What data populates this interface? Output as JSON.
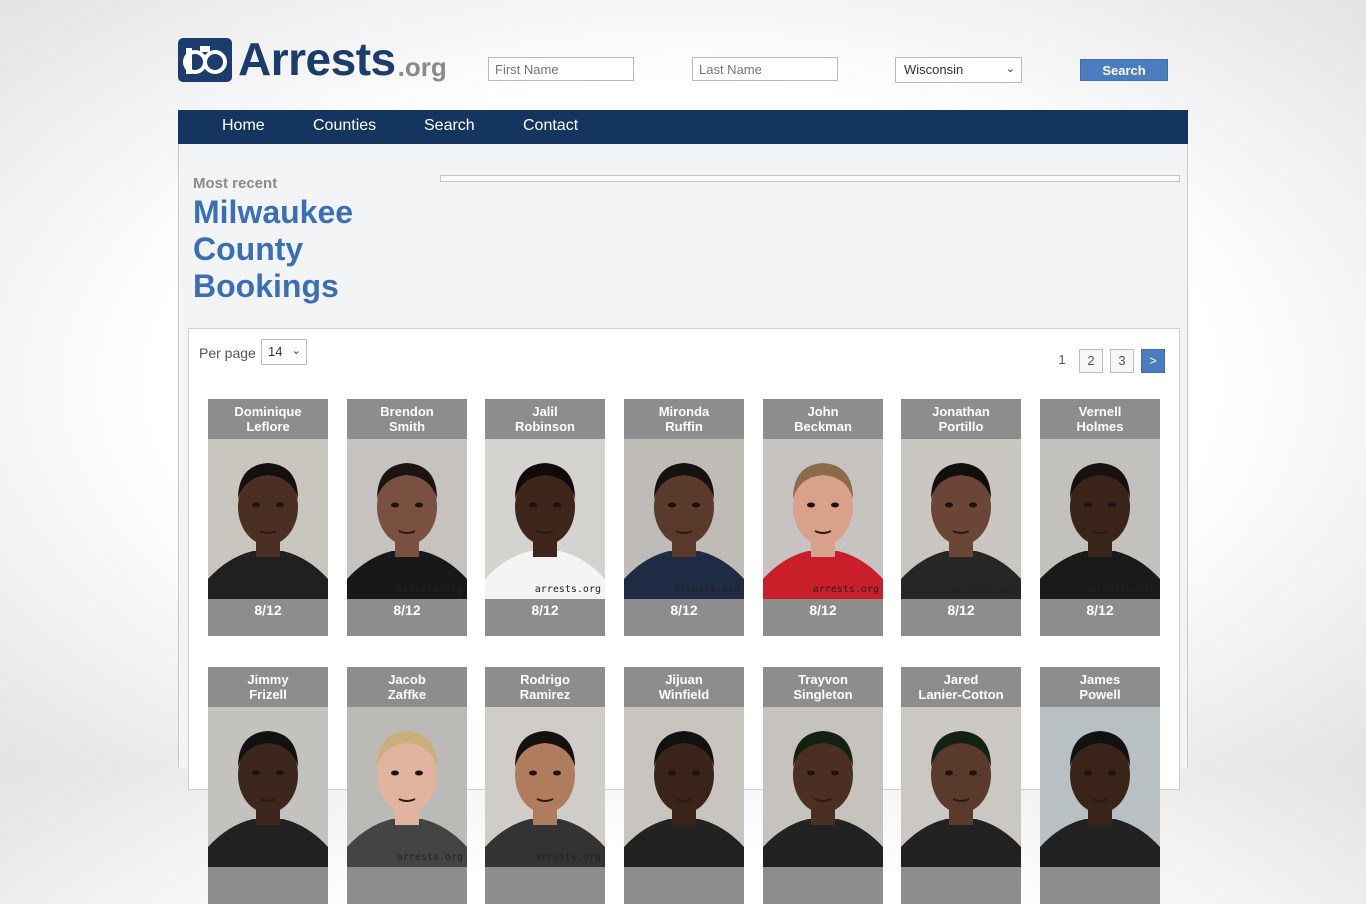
{
  "site": {
    "logo_text": "Arrests",
    "logo_suffix": ".org"
  },
  "search": {
    "first_placeholder": "First Name",
    "last_placeholder": "Last Name",
    "state_selected": "Wisconsin",
    "button_label": "Search"
  },
  "nav": {
    "items": [
      "Home",
      "Counties",
      "Search",
      "Contact"
    ]
  },
  "heading": {
    "kicker": "Most recent",
    "title_line1": "Milwaukee",
    "title_line2": "County",
    "title_line3": "Bookings"
  },
  "listing": {
    "per_page_label": "Per page",
    "per_page_value": "14",
    "pagination": {
      "current": "1",
      "pages": [
        "2",
        "3"
      ],
      "next": ">"
    }
  },
  "watermark": "arrests.org",
  "bookings": [
    {
      "first": "Dominique",
      "last": "Leflore",
      "date": "8/12",
      "bg": "#c9c6c0",
      "skin": "#4a2f22",
      "hair": "#141010",
      "shirt": "#202020"
    },
    {
      "first": "Brendon",
      "last": "Smith",
      "date": "8/12",
      "bg": "#c5c2bf",
      "skin": "#7a5141",
      "hair": "#1a1412",
      "shirt": "#181818"
    },
    {
      "first": "Jalil",
      "last": "Robinson",
      "date": "8/12",
      "bg": "#d5d3d0",
      "skin": "#3e261b",
      "hair": "#0e0b0a",
      "shirt": "#f4f4f4"
    },
    {
      "first": "Mironda",
      "last": "Ruffin",
      "date": "8/12",
      "bg": "#bfbcb7",
      "skin": "#5a3a2a",
      "hair": "#151110",
      "shirt": "#1f2a44"
    },
    {
      "first": "John",
      "last": "Beckman",
      "date": "8/12",
      "bg": "#c6c3c0",
      "skin": "#d9a18c",
      "hair": "#8b6b4a",
      "shirt": "#c81f2b"
    },
    {
      "first": "Jonathan",
      "last": "Portillo",
      "date": "8/12",
      "bg": "#cac7c3",
      "skin": "#6b4636",
      "hair": "#120e0c",
      "shirt": "#262626"
    },
    {
      "first": "Vernell",
      "last": "Holmes",
      "date": "8/12",
      "bg": "#c3c1be",
      "skin": "#3a2419",
      "hair": "#16110f",
      "shirt": "#1a1a1a"
    },
    {
      "first": "Jimmy",
      "last": "Frizell",
      "date": "",
      "bg": "#c4c2bf",
      "skin": "#3d261c",
      "hair": "#111",
      "shirt": "#222"
    },
    {
      "first": "Jacob",
      "last": "Zaffke",
      "date": "",
      "bg": "#bcbab7",
      "skin": "#e0b49e",
      "hair": "#c9b07a",
      "shirt": "#444"
    },
    {
      "first": "Rodrigo",
      "last": "Ramirez",
      "date": "",
      "bg": "#d0cdc9",
      "skin": "#b07c5e",
      "hair": "#15110e",
      "shirt": "#333"
    },
    {
      "first": "Jijuan",
      "last": "Winfield",
      "date": "",
      "bg": "#c8c5c1",
      "skin": "#3a2419",
      "hair": "#111",
      "shirt": "#222"
    },
    {
      "first": "Trayvon",
      "last": "Singleton",
      "date": "",
      "bg": "#c6c3bf",
      "skin": "#4b2f22",
      "hair": "#121",
      "shirt": "#222"
    },
    {
      "first": "Jared",
      "last": "Lanier-Cotton",
      "date": "",
      "bg": "#cbc8c4",
      "skin": "#5a3a2a",
      "hair": "#121",
      "shirt": "#222"
    },
    {
      "first": "James",
      "last": "Powell",
      "date": "",
      "bg": "#b8c0c4",
      "skin": "#3a2419",
      "hair": "#111",
      "shirt": "#222"
    }
  ]
}
